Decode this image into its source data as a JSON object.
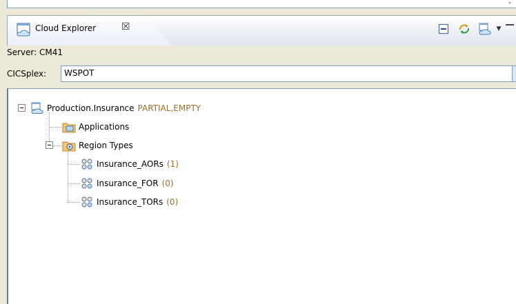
{
  "view": {
    "title": "Cloud Explorer",
    "close_glyph": "☒"
  },
  "toolbar": {
    "icons": [
      "collapse-all-icon",
      "refresh-icon",
      "cloud-select-icon",
      "view-menu-icon",
      "minimize-icon"
    ],
    "dropdown_glyph": "▼"
  },
  "server": {
    "label": "Server: CM41"
  },
  "cicsplex": {
    "label": "CICSplex:",
    "value": "WSPOT"
  },
  "tree": {
    "root": {
      "label": "Production.Insurance",
      "status": "PARTIAL,EMPTY"
    },
    "applications": {
      "label": "Applications"
    },
    "region_types": {
      "label": "Region Types",
      "items": [
        {
          "label": "Insurance_AORs",
          "count": "(1)"
        },
        {
          "label": "Insurance_FOR",
          "count": "(0)"
        },
        {
          "label": "Insurance_TORs",
          "count": "(0)"
        }
      ]
    }
  },
  "colors": {
    "status_text": "#a06e2a",
    "panel_bg": "#ece9d8"
  }
}
